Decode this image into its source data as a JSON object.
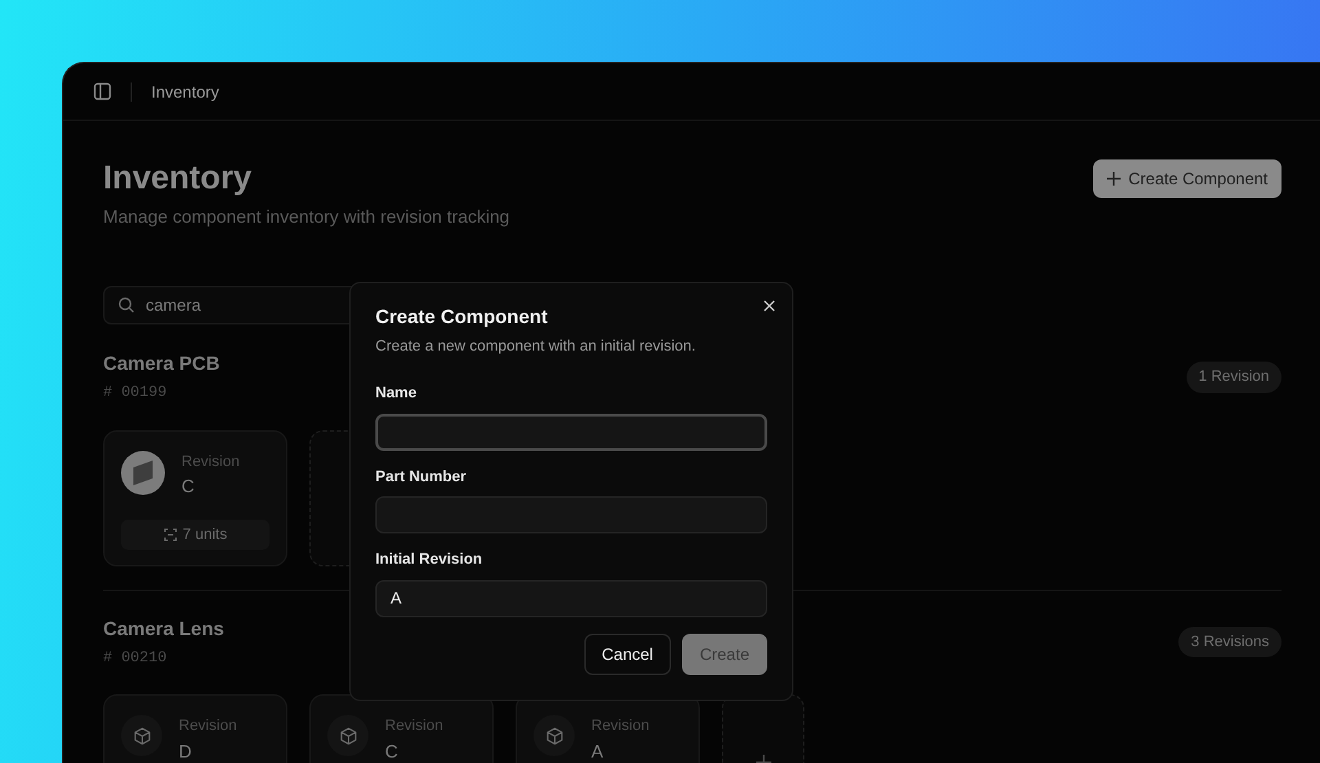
{
  "window": {
    "breadcrumb": "Inventory"
  },
  "header": {
    "title": "Inventory",
    "subtitle": "Manage component inventory with revision tracking",
    "create_button": "Create Component"
  },
  "search": {
    "value": "camera"
  },
  "components": [
    {
      "name": "Camera PCB",
      "part_number": "# 00199",
      "revision_count": "1 Revision",
      "revisions": [
        {
          "kind": "photo",
          "label": "Revision",
          "letter": "C",
          "units": "7 units"
        },
        {
          "kind": "add"
        }
      ]
    },
    {
      "name": "Camera Lens",
      "part_number": "# 00210",
      "revision_count": "3 Revisions",
      "revisions": [
        {
          "kind": "box",
          "label": "Revision",
          "letter": "D"
        },
        {
          "kind": "box",
          "label": "Revision",
          "letter": "C"
        },
        {
          "kind": "box",
          "label": "Revision",
          "letter": "A"
        },
        {
          "kind": "add"
        }
      ]
    }
  ],
  "dialog": {
    "title": "Create Component",
    "description": "Create a new component with an initial revision.",
    "fields": [
      {
        "label": "Name",
        "focused": true
      },
      {
        "label": "Part Number",
        "focused": false
      },
      {
        "label": "Initial Revision",
        "value": "A",
        "focused": false
      }
    ],
    "buttons": [
      {
        "kind": "secondary",
        "label": "Cancel",
        "disabled": false
      },
      {
        "kind": "primary",
        "label": "Create",
        "disabled": true
      }
    ]
  }
}
